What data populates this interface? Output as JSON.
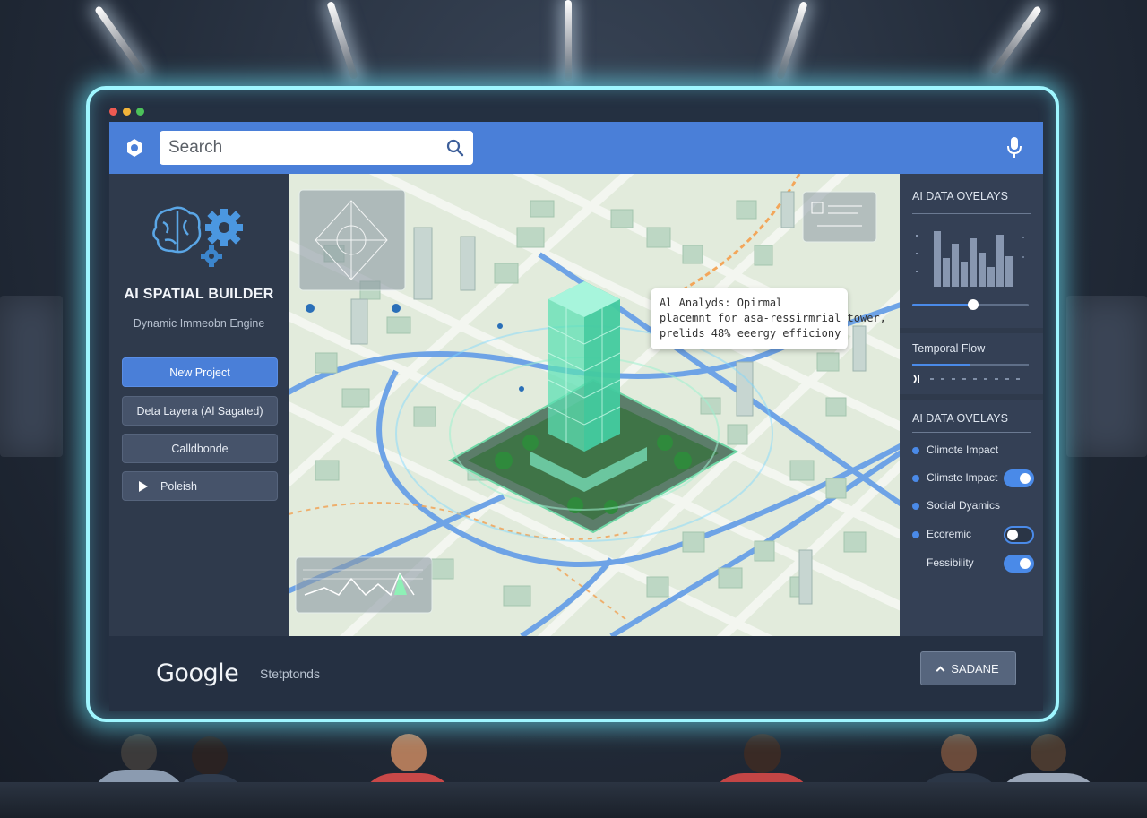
{
  "colors": {
    "accent": "#4a7fd8",
    "glow": "#9ff6ff",
    "sidebar": "#2f3a4c",
    "tower": "#5ee0b4"
  },
  "window": {
    "controls": [
      "close-dot",
      "minimize-dot",
      "maximize-dot"
    ]
  },
  "topbar": {
    "search_placeholder": "Search",
    "icons": [
      "app-logo-icon",
      "search-icon",
      "microphone-icon"
    ]
  },
  "sidebar": {
    "title": "AI SPATIAL BUILDER",
    "subtitle": "Dynamic Immeobn Engine",
    "buttons": [
      {
        "label": "New Project"
      },
      {
        "label": "Deta Layera (Al Sagated)"
      },
      {
        "label": "Calldbonde"
      },
      {
        "label": "Poleish"
      }
    ]
  },
  "map": {
    "callout": {
      "line1": "Al Analyds:  Opirmal",
      "line2": "placemnt for asa-ressirmrial tower,",
      "line3": "prelids 48% eeergy efficiony"
    }
  },
  "right_panel": {
    "overlays_title": "AI DATA OVELAYS",
    "slider_value": 0.52,
    "temporal_title": "Temporal Flow",
    "temporal_progress": 0.5,
    "layers_title": "AI DATA OVELAYS",
    "layers": [
      {
        "label": "Climote Impact",
        "toggle": null
      },
      {
        "label": "Climste Impact",
        "toggle": "on"
      },
      {
        "label": "Social Dyamics",
        "toggle": null
      },
      {
        "label": "Ecoremic",
        "toggle": "off"
      },
      {
        "label": "Fessibility",
        "toggle": "on"
      }
    ]
  },
  "bottombar": {
    "brand": "Google",
    "subtitle": "Stetptonds",
    "button_label": "SADANE"
  }
}
